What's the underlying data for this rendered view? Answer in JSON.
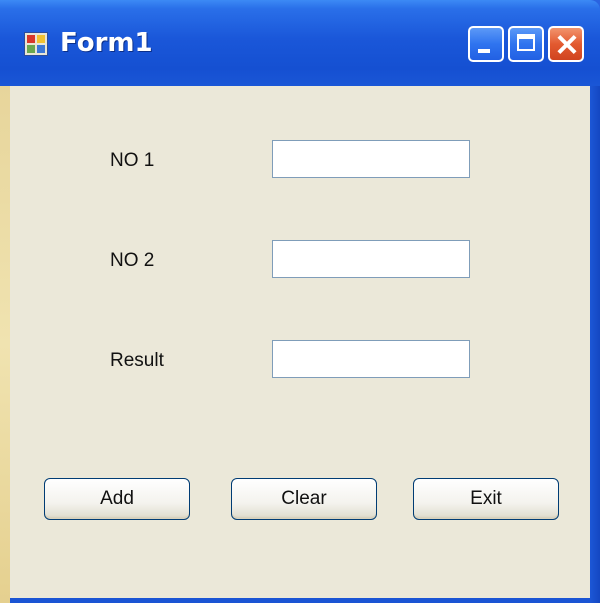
{
  "window": {
    "title": "Form1",
    "icon": "form-app-icon",
    "controls": [
      "minimize-icon",
      "maximize-icon",
      "close-icon"
    ]
  },
  "form": {
    "fields": [
      {
        "label": "NO 1",
        "value": ""
      },
      {
        "label": "NO 2",
        "value": ""
      },
      {
        "label": "Result",
        "value": ""
      }
    ],
    "buttons": {
      "add": "Add",
      "clear": "Clear",
      "exit": "Exit"
    }
  },
  "colors": {
    "titlebar": "#1a57d9",
    "client_background": "#ebe8d9",
    "textbox_border": "#7f9db9",
    "button_border": "#003c74",
    "close_button": "#e35a30"
  }
}
